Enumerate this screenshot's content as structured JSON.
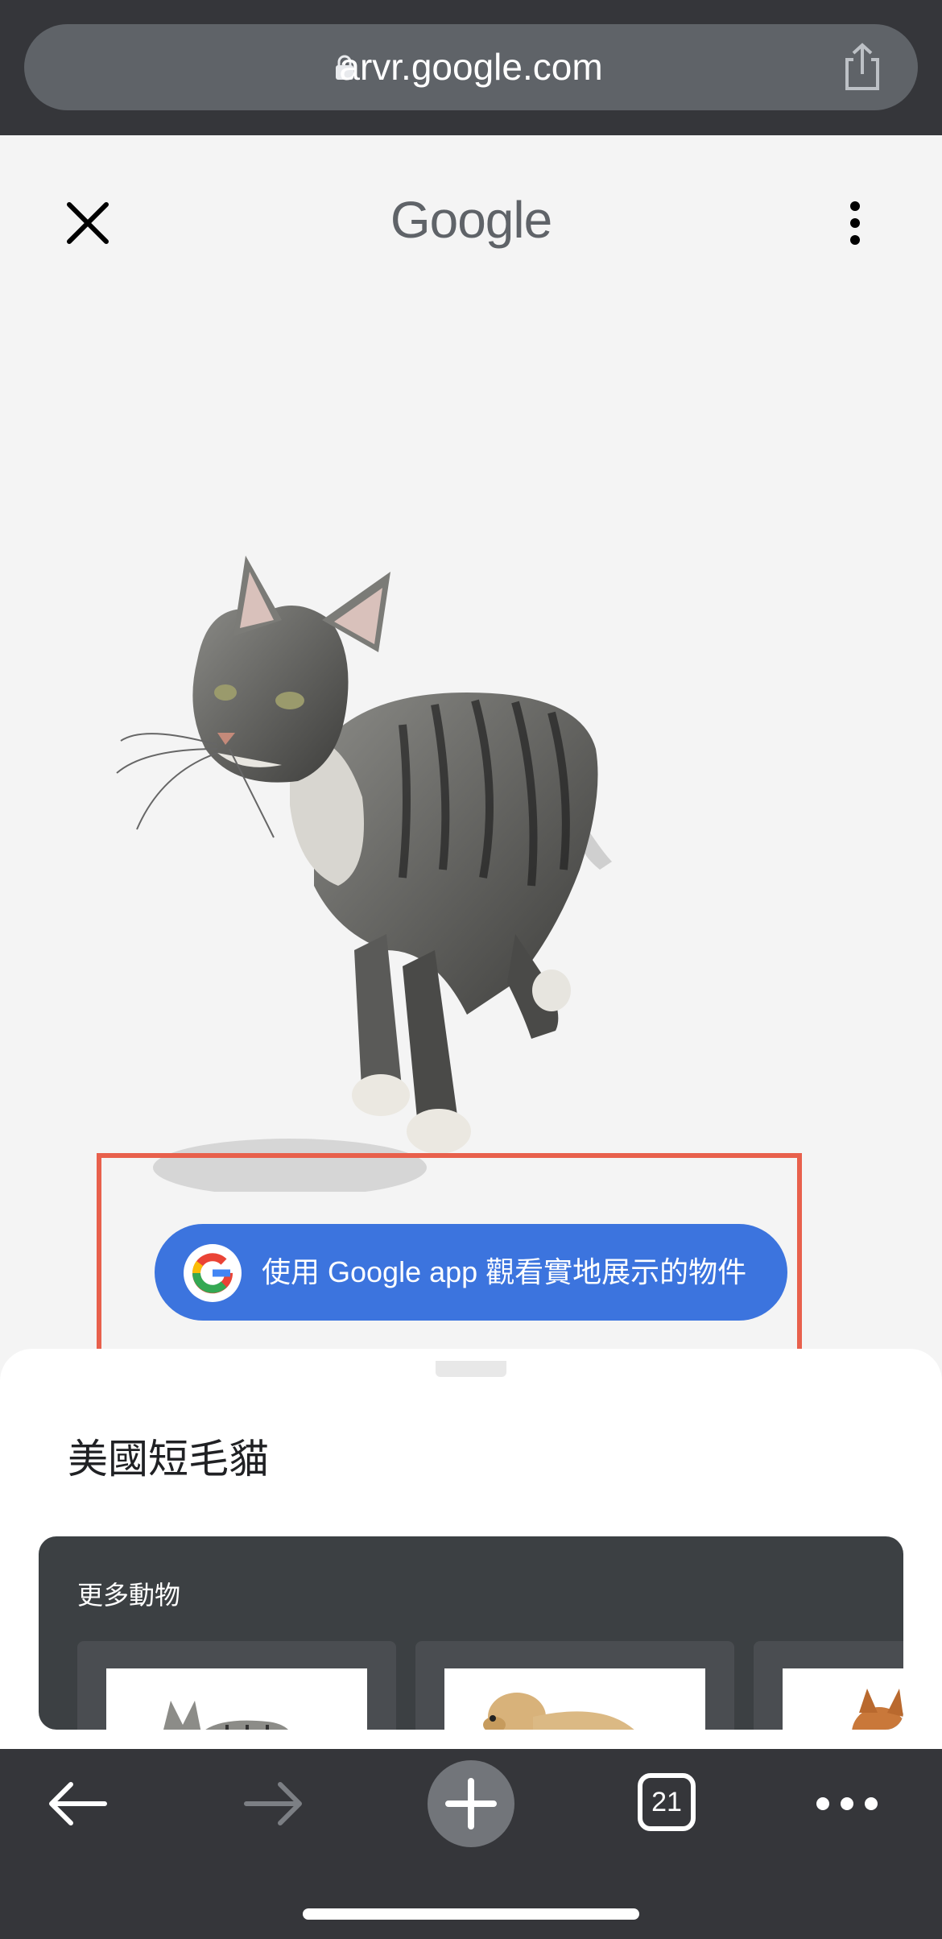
{
  "browser": {
    "url": "arvr.google.com",
    "tab_count": "21"
  },
  "header": {
    "logo_text": "Google"
  },
  "ar_button": {
    "label": "使用 Google app 觀看實地展示的物件"
  },
  "sheet": {
    "title": "美國短毛貓",
    "more_section": {
      "title": "更多動物",
      "cards": [
        {
          "icon": "cat-thumbnail"
        },
        {
          "icon": "dog-thumbnail"
        },
        {
          "icon": "shiba-thumbnail"
        }
      ]
    }
  },
  "colors": {
    "accent_button": "#3c74de",
    "highlight_border": "#e8604c",
    "toolbar_bg": "#35363a"
  }
}
